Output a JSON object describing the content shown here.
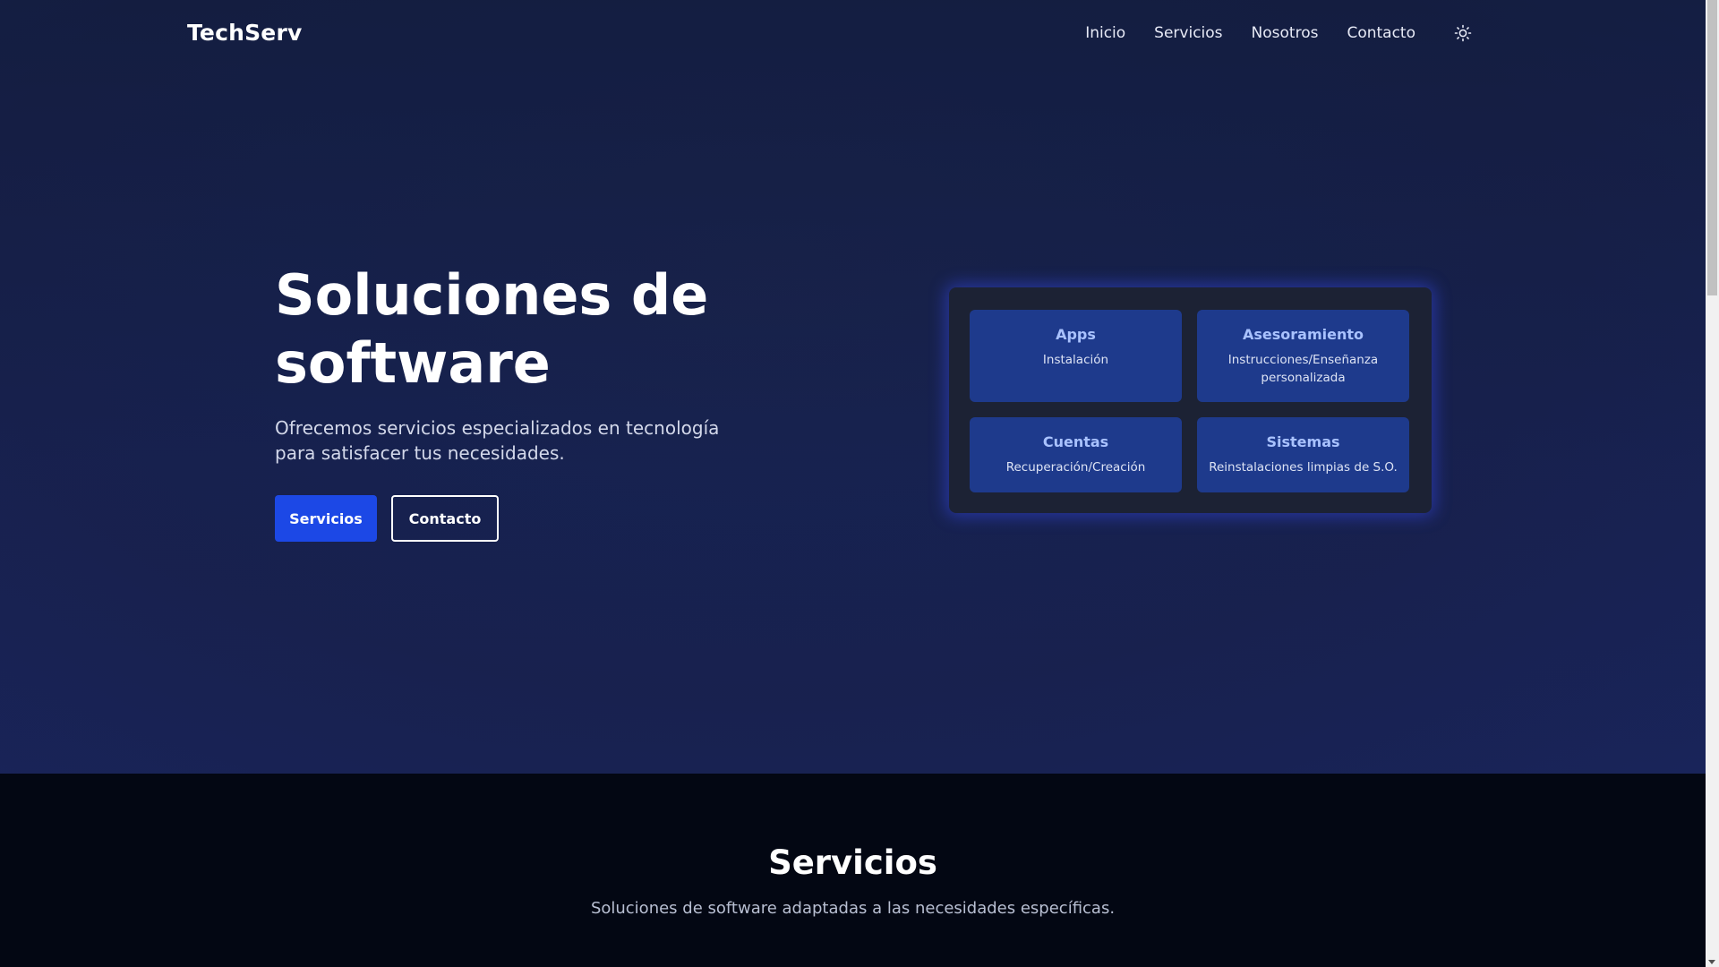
{
  "brand": "TechServ",
  "nav": {
    "items": [
      "Inicio",
      "Servicios",
      "Nosotros",
      "Contacto"
    ],
    "theme_icon": "sun-icon"
  },
  "hero": {
    "title": "Soluciones de software",
    "subtitle": "Ofrecemos servicios especializados en tecnología para satisfacer tus necesidades.",
    "primary_button": "Servicios",
    "secondary_button": "Contacto"
  },
  "cards": [
    {
      "title": "Apps",
      "desc": "Instalación"
    },
    {
      "title": "Asesoramiento",
      "desc": "Instrucciones/Enseñanza personalizada"
    },
    {
      "title": "Cuentas",
      "desc": "Recuperación/Creación"
    },
    {
      "title": "Sistemas",
      "desc": "Reinstalaciones limpias de S.O."
    }
  ],
  "services": {
    "title": "Servicios",
    "subtitle": "Soluciones de software adaptadas a las necesidades específicas."
  },
  "colors": {
    "accent": "#1c48e6",
    "card_bg": "#1e3a8c",
    "card_title": "#a9c2ff"
  }
}
